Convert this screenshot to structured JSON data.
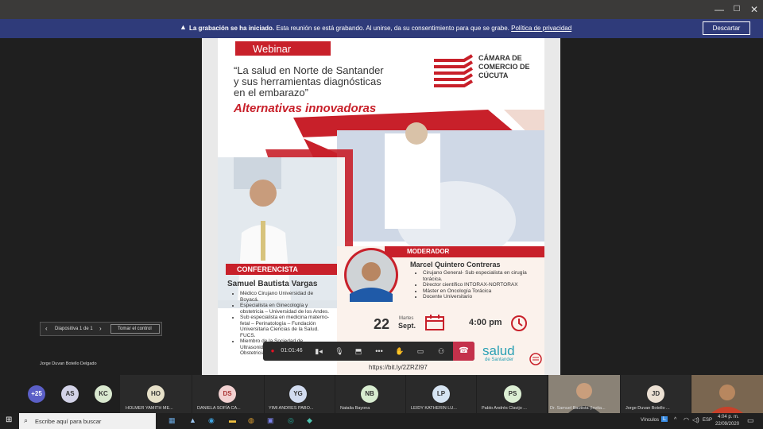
{
  "window": {
    "min": "—",
    "max": "☐",
    "close": "✕"
  },
  "banner": {
    "title": "La grabación se ha iniciado.",
    "text": "Esta reunión se está grabando. Al unirse, da su consentimiento para que se grabe.",
    "link": "Política de privacidad",
    "dismiss": "Descartar"
  },
  "poster": {
    "tag": "Webinar",
    "title_line1": "“La salud en Norte de Santander",
    "title_line2": "y sus herramientas diagnósticas",
    "title_line3": "en el embarazo”",
    "subtitle": "Alternativas innovadoras",
    "org_line1": "CÁMARA DE",
    "org_line2": "COMERCIO DE",
    "org_line3": "CÚCUTA",
    "speaker_tag": "CONFERENCISTA",
    "speaker_name": "Samuel Bautista Vargas",
    "speaker_bullets": [
      "Médico Cirujano Universidad de Boyacá.",
      "Especialista en Ginecología y obstetricia – Universidad de los Andes.",
      "Sub especialista en medicina materno-fetal – Perinatología – Fundación Universitaria Ciencias de la Salud. FUCS.",
      "Miembro de la Sociedad de Ultrasonido en Ginecología y Obstetricia."
    ],
    "moderator_tag": "MODERADOR",
    "moderator_name": "Marcel Quintero Contreras",
    "moderator_bullets": [
      "Cirujano General- Sub especialista en cirugía torácica.",
      "Director científico INTORAX-NORTORAX",
      "Máster en Oncología Torácica",
      "Docente Universitario"
    ],
    "date_day": "22",
    "date_weekday": "Martes",
    "date_month": "Sept.",
    "time": "4:00 pm",
    "url": "https://bit.ly/2ZRZI97",
    "logo_text": "salud",
    "logo_sub": "de Santander"
  },
  "slidenav": {
    "label": "Diapositiva 1 de 1",
    "control": "Tomar el control"
  },
  "presenter_name": "Jorge Duvan Botello Delgado",
  "callbar": {
    "timer": "01:01:46"
  },
  "participants": {
    "more": "+25",
    "initials_small": [
      "AS",
      "KC"
    ],
    "tiles": [
      {
        "initials": "HO",
        "name": "HOLMER YAMITH ME..."
      },
      {
        "initials": "DS",
        "name": "DANIELA SOFÍA CA..."
      },
      {
        "initials": "YG",
        "name": "YIMI ANDRES PABO..."
      },
      {
        "initials": "NB",
        "name": "Natalia Bayona"
      },
      {
        "initials": "LP",
        "name": "LEIDY KATHERIN LU..."
      },
      {
        "initials": "PS",
        "name": "Pablo Andrés Clavijo ..."
      },
      {
        "initials": "",
        "name": "Dr. Samuel Bautista (Invita..."
      },
      {
        "initials": "JD",
        "name": "Jorge Duvan Botello ..."
      }
    ]
  },
  "taskbar": {
    "search_placeholder": "Escribe aquí para buscar",
    "links": "Vínculos",
    "lang": "ESP",
    "time": "4:04 p. m.",
    "date": "22/09/2020"
  },
  "colors": {
    "banner": "#2f3b7a",
    "poster_red": "#c8202a",
    "hangup": "#c4314b"
  }
}
